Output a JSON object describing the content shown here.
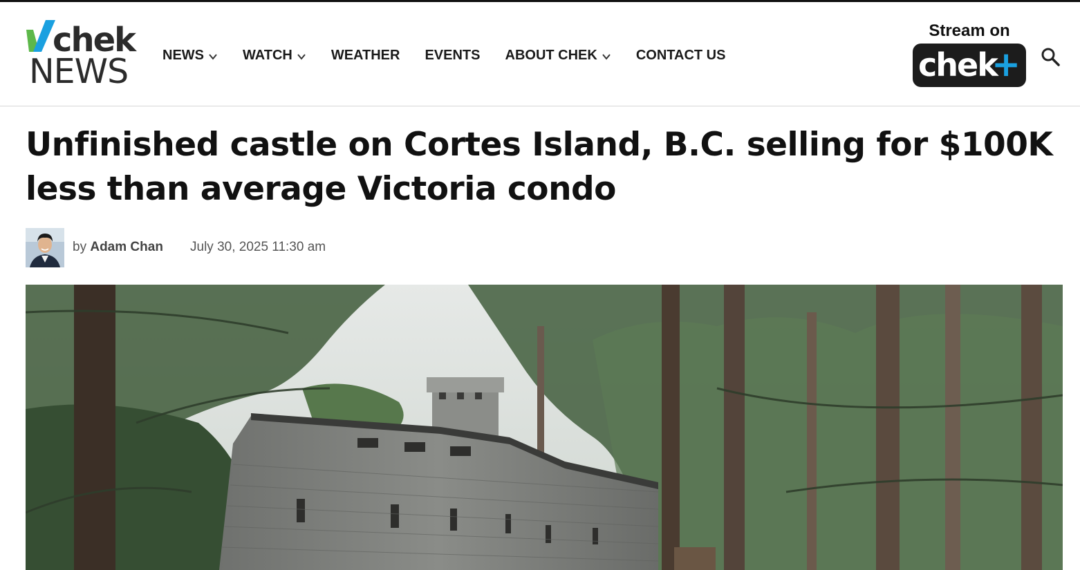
{
  "site": {
    "logo_word_1": "chek",
    "logo_word_2": "NEWS",
    "brand_green": "#5db84a",
    "brand_blue": "#1aa0e0"
  },
  "nav": {
    "items": [
      {
        "label": "NEWS",
        "has_dropdown": true
      },
      {
        "label": "WATCH",
        "has_dropdown": true
      },
      {
        "label": "WEATHER",
        "has_dropdown": false
      },
      {
        "label": "EVENTS",
        "has_dropdown": false
      },
      {
        "label": "ABOUT CHEK",
        "has_dropdown": true
      },
      {
        "label": "CONTACT US",
        "has_dropdown": false
      }
    ]
  },
  "stream": {
    "label": "Stream on",
    "badge_text": "chek",
    "badge_plus": "+"
  },
  "search": {
    "icon": "search-icon"
  },
  "article": {
    "headline": "Unfinished castle on Cortes Island, B.C. selling for $100K less than average Victoria condo",
    "byline_prefix": "by",
    "author": "Adam Chan",
    "date": "July 30, 2025 11:30 am",
    "hero_image": "unfinished concrete castle surrounded by tall evergreen trees"
  }
}
